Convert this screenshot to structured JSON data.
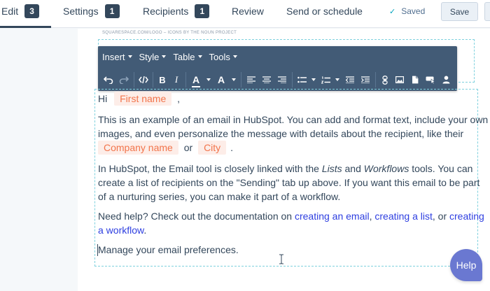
{
  "nav": {
    "tabs": [
      {
        "label": "Edit",
        "badge": "3"
      },
      {
        "label": "Settings",
        "badge": "1"
      },
      {
        "label": "Recipients",
        "badge": "1"
      },
      {
        "label": "Review",
        "badge": ""
      },
      {
        "label": "Send or schedule",
        "badge": ""
      }
    ],
    "active_tab": "Edit",
    "status": "Saved",
    "save_label": "Save"
  },
  "logo_caption": "SQUARESPACE.COM/LOGO – ICONS BY THE NOUN PROJECT",
  "editor": {
    "menus": [
      "Insert",
      "Style",
      "Table",
      "Tools"
    ],
    "buttons": [
      "undo-icon",
      "redo-icon",
      "source-code-icon",
      "bold-icon",
      "italic-icon",
      "font-color-icon",
      "background-color-icon",
      "align-left-icon",
      "align-center-icon",
      "align-right-icon",
      "bulleted-list-icon",
      "numbered-list-icon",
      "outdent-icon",
      "indent-icon",
      "link-icon",
      "image-icon",
      "document-icon",
      "cta-icon",
      "personalize-icon"
    ],
    "bold_glyph": "B",
    "italic_glyph": "I",
    "font_color_glyph": "A",
    "bg_color_glyph": "A"
  },
  "body": {
    "greeting": "Hi",
    "greeting_token": "First name",
    "greeting_suffix": ",",
    "p1_line1": "This is an example of an email in HubSpot. You can add and format text, include your own",
    "p1_line2": "images, and even personalize the message with details about the recipient, like their",
    "p1_token1": "Company name",
    "p1_or": "or",
    "p1_token2": "City",
    "p1_end": ".",
    "p2_line1_a": "In HubSpot, the Email tool is closely linked with the ",
    "p2_lists": "Lists",
    "p2_and": " and ",
    "p2_workflows": "Workflows",
    "p2_line1_b": " tools. You can",
    "p2_line2": "create a list of recipients on the \"Sending\" tab up above. If you want this email to be part",
    "p2_line3": "of a nurturing series, you can make it part of a workflow.",
    "p3_prefix": "Need help? Check out the documentation on ",
    "p3_link1": "creating an email",
    "p3_comma": ", ",
    "p3_link2": "creating a list",
    "p3_or": ", or ",
    "p3_link3_a": "creating",
    "p3_link3_b": "a workflow",
    "p3_end": ".",
    "footer": "Manage your email preferences."
  },
  "help_label": "Help",
  "colors": {
    "nav_dark": "#33475b",
    "toolbar": "#425b76",
    "token_bg": "#fdede8",
    "token_text": "#f2744b",
    "link": "#2d3ee0",
    "help": "#6a78d1"
  }
}
